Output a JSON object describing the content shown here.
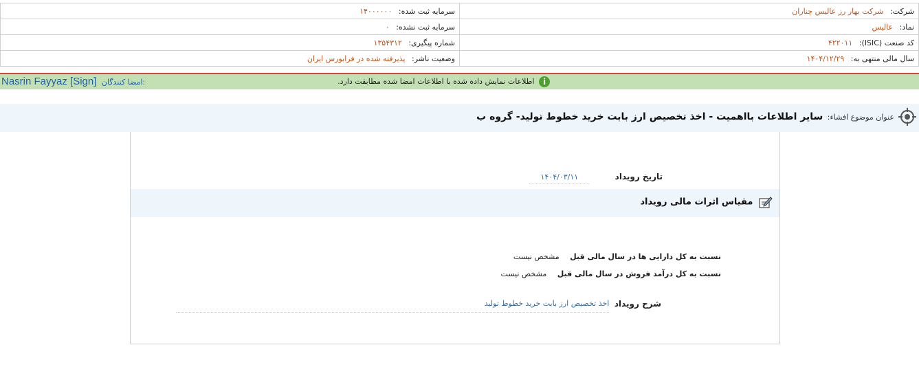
{
  "company_info": {
    "company_label": "شرکت:",
    "company_value": "شرکت بهار رز عالیس چناران",
    "registered_capital_label": "سرمایه ثبت شده:",
    "registered_capital_value": "۱۴۰۰۰۰۰۰",
    "symbol_label": "نماد:",
    "symbol_value": "عالیس",
    "unregistered_capital_label": "سرمایه ثبت نشده:",
    "unregistered_capital_value": "۰",
    "isic_label": "کد صنعت (ISIC):",
    "isic_value": "۴۲۲۰۱۱",
    "tracking_label": "شماره پیگیری:",
    "tracking_value": "۱۳۵۴۳۱۲",
    "fiscal_year_label": "سال مالی منتهی به:",
    "fiscal_year_value": "۱۴۰۴/۱۲/۲۹",
    "publisher_status_label": "وضعیت ناشر:",
    "publisher_status_value": "پذیرفته شده در فرابورس ایران"
  },
  "verification": {
    "signers_label": "امضا کنندگان:",
    "signer_name": "Nasrin Fayyaz [Sign]",
    "match_message": "اطلاعات نمایش داده شده با اطلاعات امضا شده مطابقت دارد.",
    "icon": "info-icon",
    "bar_color": "#c3e0b4",
    "alert_line_color": "#e3423c"
  },
  "subject": {
    "label": "عنوان موضوع افشاء:",
    "title": "سایر اطلاعات بااهمیت - اخذ تخصیص ارز بابت خرید خطوط تولید- گروه ب"
  },
  "event": {
    "date_label": "تاریخ رویداد",
    "date_value": "۱۴۰۴/۰۳/۱۱",
    "impact_heading": "مقیاس اثرات مالی رویداد",
    "ratios": [
      {
        "label": "نسبت به کل دارایی ها در سال مالی قبل",
        "value": "مشخص نیست"
      },
      {
        "label": "نسبت به کل درآمد فروش در سال مالی قبل",
        "value": "مشخص نیست"
      }
    ],
    "description_label": "شرح رویداد",
    "description_value": "اخذ تخصیص ارز بابت خرید خطوط تولید"
  }
}
